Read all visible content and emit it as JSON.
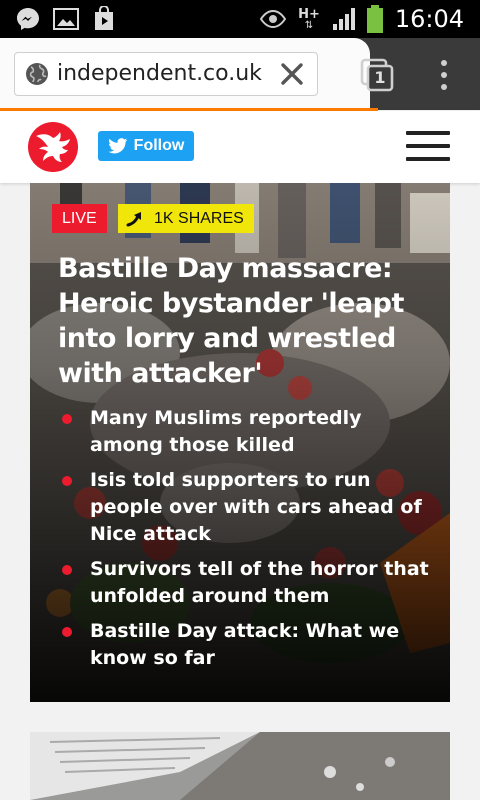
{
  "status_bar": {
    "time": "16:04",
    "network_type": "H+",
    "icons": [
      "messenger-icon",
      "gallery-icon",
      "play-store-icon",
      "eye-icon",
      "signal-icon",
      "battery-icon"
    ]
  },
  "browser": {
    "url": "independent.co.uk",
    "tab_count": "1",
    "accent_color": "#ff7b00"
  },
  "site_header": {
    "follow_label": "Follow",
    "brand_color": "#ec1c2e",
    "twitter_color": "#1da1f2"
  },
  "hero": {
    "live_label": "LIVE",
    "shares_label": "1K SHARES",
    "headline": "Bastille Day massacre: Heroic bystander 'leapt into lorry and wrestled with attacker'",
    "bullets": [
      "Many Muslims reportedly among those killed",
      "Isis told supporters to run people over with cars ahead of Nice attack",
      "Survivors tell of the horror that unfolded around them",
      "Bastille Day attack: What we know so far"
    ]
  }
}
